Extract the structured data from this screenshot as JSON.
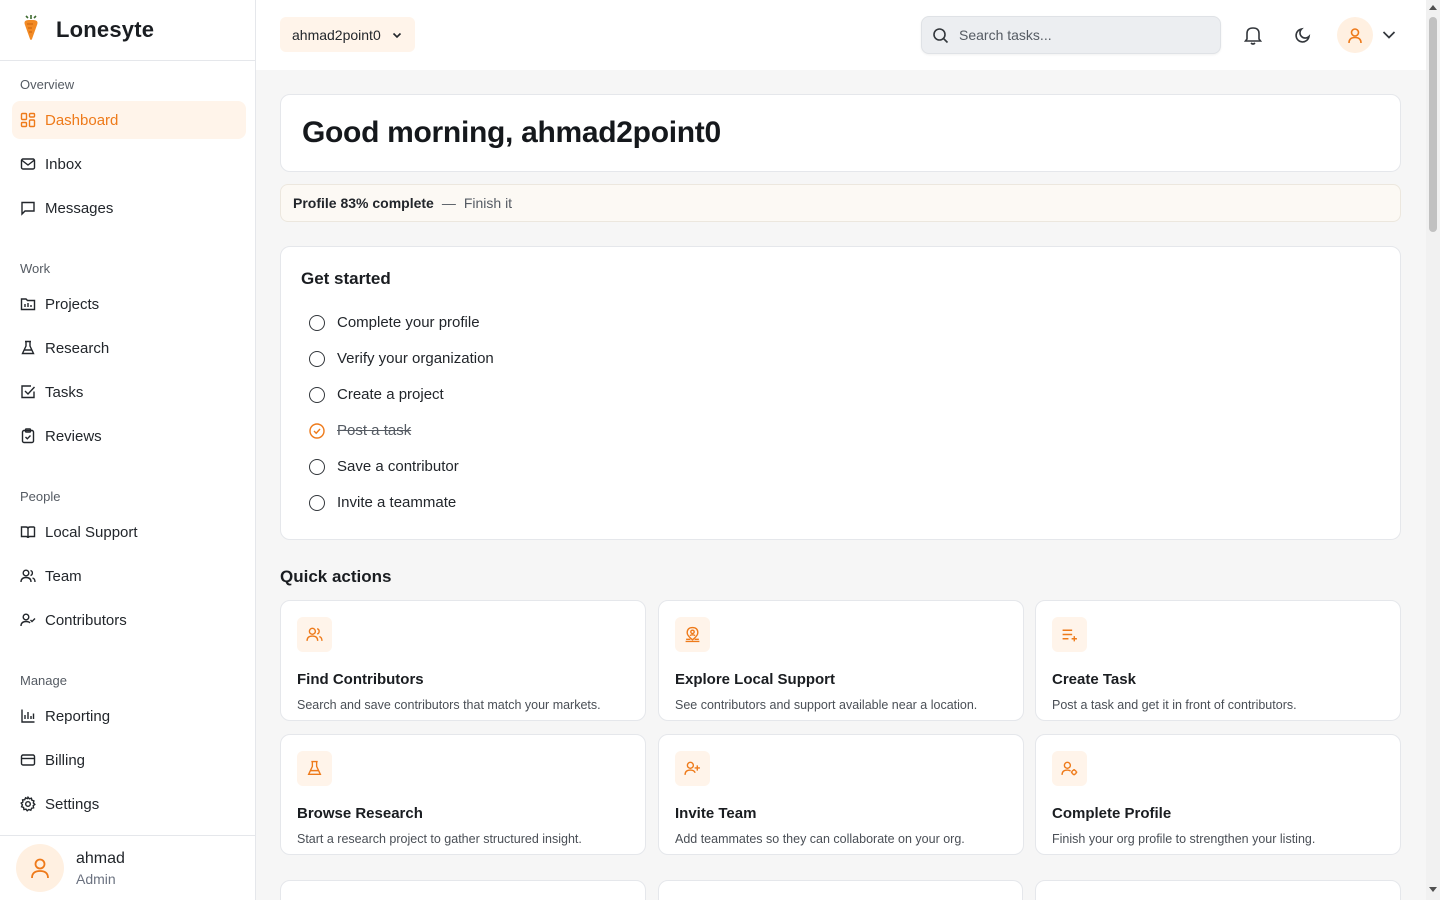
{
  "brand": {
    "name": "Lonesyte"
  },
  "sidebar": {
    "sections": [
      {
        "label": "Overview"
      },
      {
        "label": "Work"
      },
      {
        "label": "People"
      },
      {
        "label": "Manage"
      }
    ],
    "items": [
      {
        "label": "Dashboard",
        "icon": "dashboard-icon",
        "active": true
      },
      {
        "label": "Inbox",
        "icon": "inbox-icon"
      },
      {
        "label": "Messages",
        "icon": "messages-icon"
      },
      {
        "label": "Projects",
        "icon": "projects-icon"
      },
      {
        "label": "Research",
        "icon": "flask-icon"
      },
      {
        "label": "Tasks",
        "icon": "checkbox-icon"
      },
      {
        "label": "Reviews",
        "icon": "clipboard-icon"
      },
      {
        "label": "Local Support",
        "icon": "book-icon"
      },
      {
        "label": "Team",
        "icon": "users-icon"
      },
      {
        "label": "Contributors",
        "icon": "user-check-icon"
      },
      {
        "label": "Reporting",
        "icon": "bar-chart-icon"
      },
      {
        "label": "Billing",
        "icon": "credit-card-icon"
      },
      {
        "label": "Settings",
        "icon": "gear-icon"
      }
    ],
    "user": {
      "name": "ahmad",
      "role": "Admin"
    }
  },
  "topbar": {
    "org": "ahmad2point0",
    "search_placeholder": "Search tasks..."
  },
  "main": {
    "greeting": "Good morning, ahmad2point0",
    "profile": {
      "status": "Profile 83% complete",
      "separator": "—",
      "link": "Finish it",
      "percent": 83
    },
    "get_started": {
      "title": "Get started",
      "items": [
        {
          "label": "Complete your profile",
          "done": false
        },
        {
          "label": "Verify your organization",
          "done": false
        },
        {
          "label": "Create a project",
          "done": false
        },
        {
          "label": "Post a task",
          "done": true
        },
        {
          "label": "Save a contributor",
          "done": false
        },
        {
          "label": "Invite a teammate",
          "done": false
        }
      ]
    },
    "quick_actions": {
      "title": "Quick actions",
      "cards": [
        {
          "title": "Find Contributors",
          "desc": "Search and save contributors that match your markets.",
          "icon": "users-icon"
        },
        {
          "title": "Explore Local Support",
          "desc": "See contributors and support available near a location.",
          "icon": "map-pin-user-icon"
        },
        {
          "title": "Create Task",
          "desc": "Post a task and get it in front of contributors.",
          "icon": "list-plus-icon"
        },
        {
          "title": "Browse Research",
          "desc": "Start a research project to gather structured insight.",
          "icon": "flask-icon"
        },
        {
          "title": "Invite Team",
          "desc": "Add teammates so they can collaborate on your org.",
          "icon": "user-plus-icon"
        },
        {
          "title": "Complete Profile",
          "desc": "Finish your org profile to strengthen your listing.",
          "icon": "user-gear-icon"
        }
      ]
    }
  },
  "colors": {
    "accent": "#ee7a1a",
    "accent_bg": "#fff4ea"
  }
}
